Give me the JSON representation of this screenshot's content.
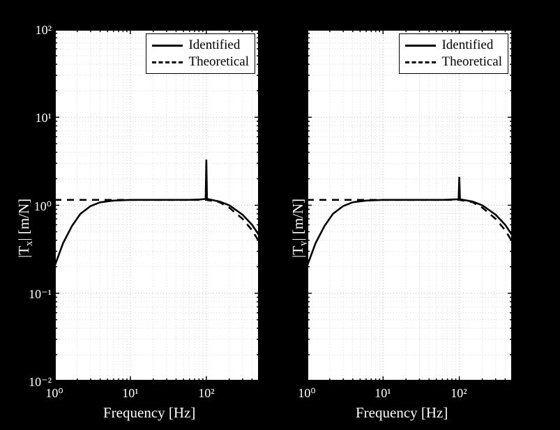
{
  "legend": {
    "identified": "Identified",
    "theoretical": "Theoretical"
  },
  "axes": {
    "xlabel": "Frequency [Hz]",
    "yticks_text": [
      "10⁻²",
      "10⁻¹",
      "10⁰",
      "10¹",
      "10²"
    ],
    "xticks_text": [
      "10⁰",
      "10¹",
      "10²"
    ]
  },
  "left": {
    "ylabel_html": "|T<span class='sub'>x</span>| [m/N]"
  },
  "right": {
    "ylabel_html": "|T<span class='sub'>y</span>| [m/N]"
  },
  "chart_data": [
    {
      "type": "line",
      "title": "",
      "xlabel": "Frequency [Hz]",
      "ylabel": "|T_x| [m/N]",
      "x_scale": "log",
      "y_scale": "log",
      "xlim": [
        1,
        500
      ],
      "ylim": [
        0.01,
        100
      ],
      "legend_position": "top-right",
      "grid": true,
      "series": [
        {
          "name": "Identified",
          "style": "solid",
          "x": [
            1,
            1.3,
            1.7,
            2.2,
            3,
            4,
            6,
            10,
            20,
            40,
            60,
            80,
            98,
            100,
            102,
            150,
            200,
            300,
            400,
            500
          ],
          "y": [
            0.2,
            0.37,
            0.58,
            0.8,
            0.98,
            1.08,
            1.13,
            1.15,
            1.15,
            1.15,
            1.15,
            1.16,
            1.18,
            3.3,
            1.18,
            1.1,
            1.0,
            0.78,
            0.6,
            0.45
          ]
        },
        {
          "name": "Theoretical",
          "style": "dashed",
          "x": [
            1,
            2,
            5,
            10,
            20,
            50,
            100,
            150,
            200,
            300,
            400,
            500
          ],
          "y": [
            1.15,
            1.15,
            1.15,
            1.15,
            1.15,
            1.15,
            1.15,
            1.08,
            0.94,
            0.7,
            0.52,
            0.38
          ]
        }
      ]
    },
    {
      "type": "line",
      "title": "",
      "xlabel": "Frequency [Hz]",
      "ylabel": "|T_y| [m/N]",
      "x_scale": "log",
      "y_scale": "log",
      "xlim": [
        1,
        500
      ],
      "ylim": [
        0.01,
        100
      ],
      "legend_position": "top-right",
      "grid": true,
      "series": [
        {
          "name": "Identified",
          "style": "solid",
          "x": [
            1,
            1.3,
            1.7,
            2.2,
            3,
            4,
            6,
            10,
            20,
            40,
            60,
            80,
            98,
            100,
            102,
            150,
            200,
            300,
            400,
            500
          ],
          "y": [
            0.2,
            0.37,
            0.58,
            0.8,
            0.98,
            1.08,
            1.13,
            1.15,
            1.15,
            1.15,
            1.15,
            1.16,
            1.17,
            2.1,
            1.17,
            1.1,
            1.0,
            0.78,
            0.6,
            0.45
          ]
        },
        {
          "name": "Theoretical",
          "style": "dashed",
          "x": [
            1,
            2,
            5,
            10,
            20,
            50,
            100,
            150,
            200,
            300,
            400,
            500
          ],
          "y": [
            1.15,
            1.15,
            1.15,
            1.15,
            1.15,
            1.15,
            1.15,
            1.08,
            0.94,
            0.7,
            0.52,
            0.38
          ]
        }
      ]
    }
  ]
}
